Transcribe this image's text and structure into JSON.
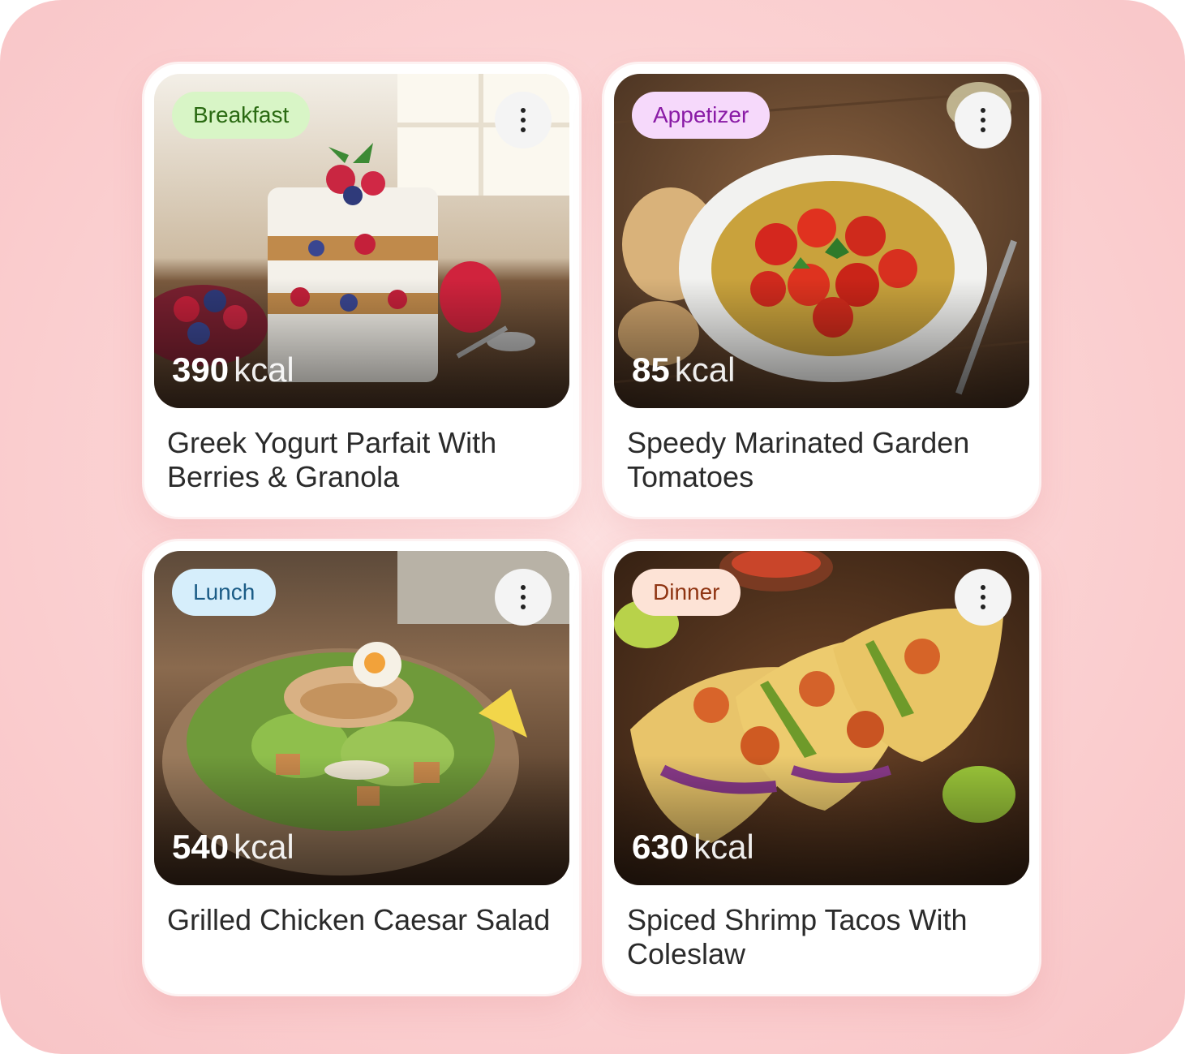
{
  "cards": [
    {
      "category": "Breakfast",
      "category_bg": "#d8f5c6",
      "category_color": "#2a6a12",
      "calories_value": "390",
      "calories_unit": "kcal",
      "title": "Greek Yogurt Parfait With Berries & Granola",
      "more_icon": "more-vertical-icon"
    },
    {
      "category": "Appetizer",
      "category_bg": "#f6d9fb",
      "category_color": "#8a1ba6",
      "calories_value": "85",
      "calories_unit": "kcal",
      "title": "Speedy Marinated Garden Tomatoes",
      "more_icon": "more-vertical-icon"
    },
    {
      "category": "Lunch",
      "category_bg": "#d6eefb",
      "category_color": "#1b5c86",
      "calories_value": "540",
      "calories_unit": "kcal",
      "title": "Grilled Chicken Caesar Salad",
      "more_icon": "more-vertical-icon"
    },
    {
      "category": "Dinner",
      "category_bg": "#fde3d6",
      "category_color": "#8f3412",
      "calories_value": "630",
      "calories_unit": "kcal",
      "title": "Spiced Shrimp Tacos With Coleslaw",
      "more_icon": "more-vertical-icon"
    }
  ]
}
